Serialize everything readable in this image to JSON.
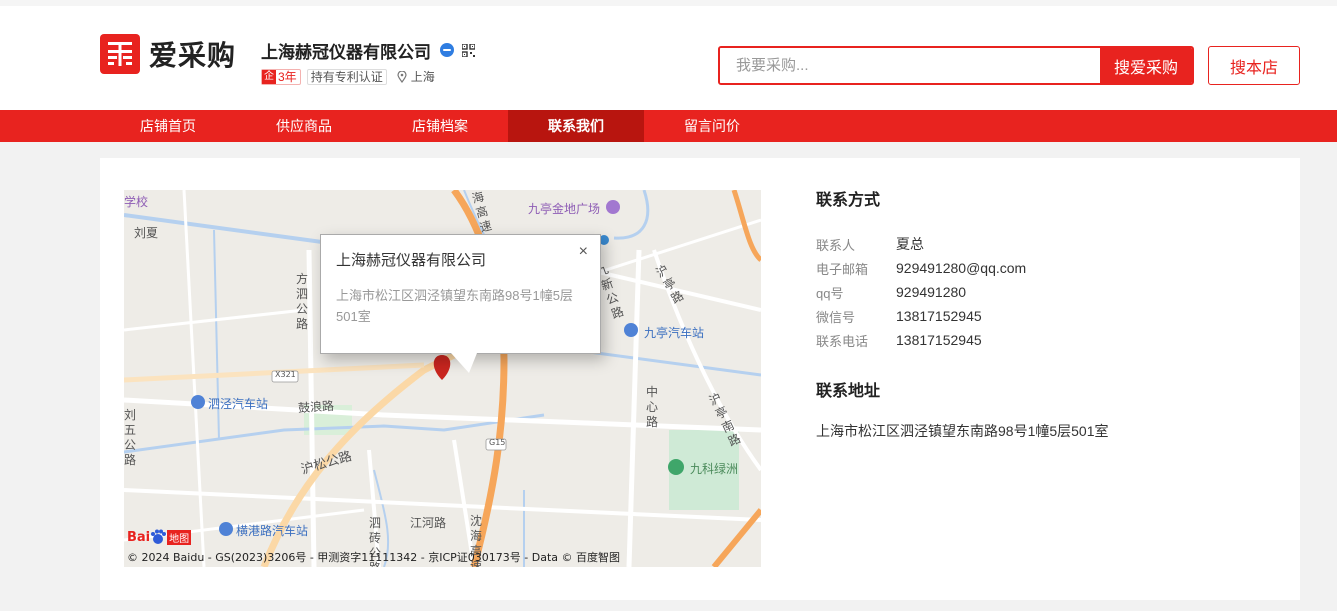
{
  "brand": {
    "logo_text": "爱采购",
    "logo_icon": "aicaigou-logo-icon"
  },
  "company": {
    "name": "上海赫冠仪器有限公司",
    "years_badge_mark": "企",
    "years_badge": "3年",
    "patent_badge": "持有专利认证",
    "location": "上海"
  },
  "search": {
    "placeholder": "我要采购...",
    "button_label": "搜爱采购",
    "store_button_label": "搜本店"
  },
  "nav": {
    "items": [
      {
        "label": "店铺首页"
      },
      {
        "label": "供应商品"
      },
      {
        "label": "店铺档案"
      },
      {
        "label": "联系我们"
      },
      {
        "label": "留言问价"
      }
    ],
    "active_index": 3
  },
  "map": {
    "popup_title": "上海赫冠仪器有限公司",
    "popup_address": "上海市松江区泗泾镇望东南路98号1幢5层501室",
    "popup_close": "×",
    "labels": {
      "xuexiao": "学校",
      "liuxia": "刘夏",
      "jiuting_plaza": "九亭金地广场",
      "jiuting_bus": "九亭汽车站",
      "sijing_bus": "泗泾汽车站",
      "gulang_road": "鼓浪路",
      "husong_road": "沪松公路",
      "hengxiang_bus": "横港路汽车站",
      "jianghe_road": "江河路",
      "jiuke_green": "九科绿洲",
      "x321": "X321",
      "g15": "G15",
      "fangsi_road": "方泗公路",
      "jiuxin_road": "九新公路",
      "huting_road1": "沪亭路",
      "huting_road2": "沪亭南路",
      "zhongxin_road": "中心路",
      "liuwu_road": "刘五公路",
      "sizhuan_road": "泗砖公路",
      "shenhai_highway": "沈海高速",
      "haigao_speed": "海高速",
      "baidu_logo_a": "Bai",
      "baidu_logo_b": "地图"
    },
    "copyright": "© 2024 Baidu - GS(2023)3206号 - 甲测资字11111342 - 京ICP证030173号 - Data © 百度智图"
  },
  "contact": {
    "title": "联系方式",
    "rows": [
      {
        "key": "联系人",
        "value": "夏总"
      },
      {
        "key": "电子邮箱",
        "value": "929491280@qq.com"
      },
      {
        "key": "qq号",
        "value": "929491280"
      },
      {
        "key": "微信号",
        "value": "13817152945"
      },
      {
        "key": "联系电话",
        "value": "13817152945"
      }
    ],
    "address_title": "联系地址",
    "address": "上海市松江区泗泾镇望东南路98号1幢5层501室"
  },
  "colors": {
    "brand_red": "#e8231f",
    "nav_active": "#b8150f"
  }
}
